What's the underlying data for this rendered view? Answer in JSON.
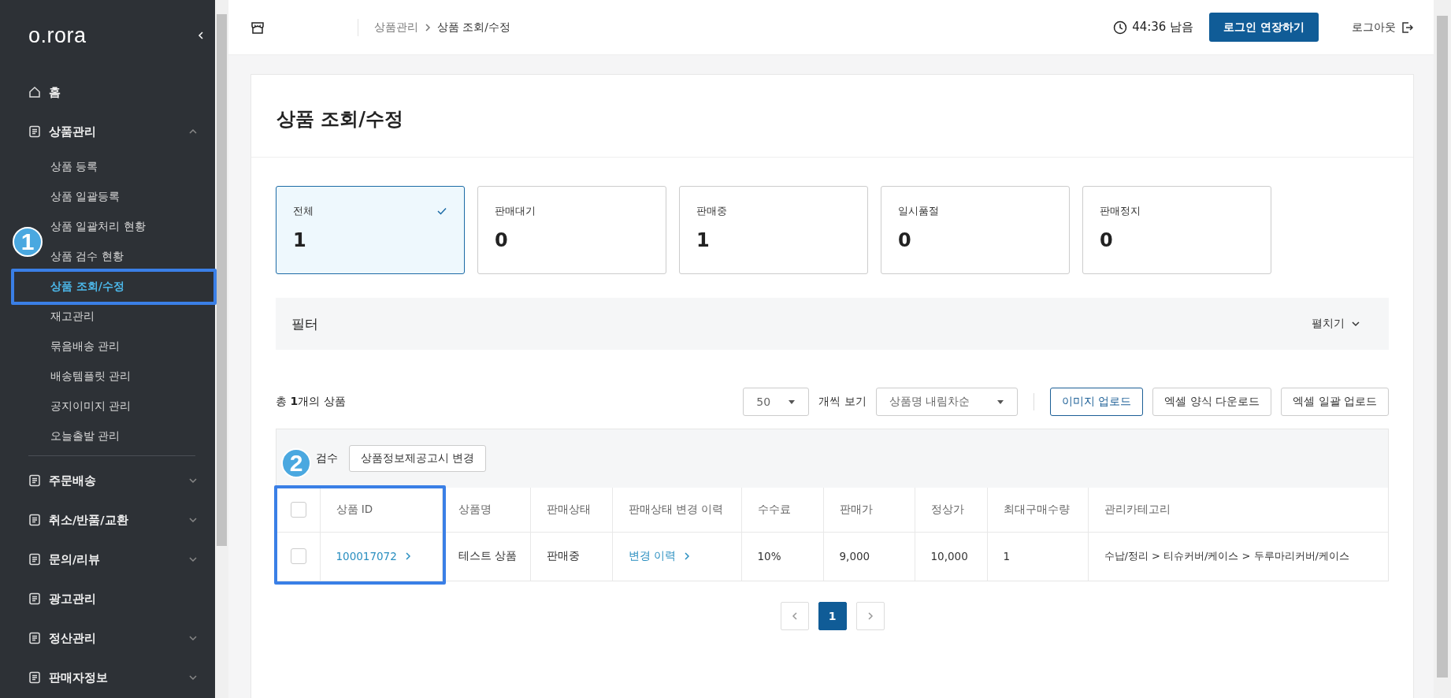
{
  "sidebar": {
    "logo": "o.rora",
    "items": [
      {
        "kind": "home",
        "label": "홈"
      },
      {
        "kind": "group",
        "label": "상품관리",
        "expanded": true,
        "children": [
          {
            "label": "상품 등록",
            "selected": false
          },
          {
            "label": "상품 일괄등록",
            "selected": false
          },
          {
            "label": "상품 일괄처리 현황",
            "selected": false
          },
          {
            "label": "상품 검수 현황",
            "selected": false
          },
          {
            "label": "상품 조회/수정",
            "selected": true
          },
          {
            "label": "재고관리",
            "selected": false
          },
          {
            "label": "묶음배송 관리",
            "selected": false
          },
          {
            "label": "배송템플릿 관리",
            "selected": false
          },
          {
            "label": "공지이미지 관리",
            "selected": false
          },
          {
            "label": "오늘출발 관리",
            "selected": false
          }
        ]
      },
      {
        "kind": "divider"
      },
      {
        "kind": "group",
        "label": "주문배송",
        "expanded": false
      },
      {
        "kind": "group",
        "label": "취소/반품/교환",
        "expanded": false
      },
      {
        "kind": "group",
        "label": "문의/리뷰",
        "expanded": false
      },
      {
        "kind": "link",
        "label": "광고관리"
      },
      {
        "kind": "group",
        "label": "정산관리",
        "expanded": false
      },
      {
        "kind": "group",
        "label": "판매자정보",
        "expanded": false
      }
    ]
  },
  "header": {
    "breadcrumb": [
      "상품관리",
      "상품 조회/수정"
    ],
    "timer": "44:36 남음",
    "extend_button": "로그인 연장하기",
    "logout": "로그아웃"
  },
  "page": {
    "title": "상품 조회/수정",
    "status_cards": [
      {
        "label": "전체",
        "count": "1",
        "selected": true
      },
      {
        "label": "판매대기",
        "count": "0",
        "selected": false
      },
      {
        "label": "판매중",
        "count": "1",
        "selected": false
      },
      {
        "label": "일시품절",
        "count": "0",
        "selected": false
      },
      {
        "label": "판매정지",
        "count": "0",
        "selected": false
      }
    ],
    "filter": {
      "title": "필터",
      "toggle": "펼치기"
    },
    "summary": "총 **1**개의 상품",
    "page_size": "50",
    "page_size_suffix": "개씩 보기",
    "sort": "상품명 내림차순",
    "buttons": [
      {
        "label": "이미지 업로드",
        "kind": "primary"
      },
      {
        "label": "엑셀 양식 다운로드",
        "kind": "plain"
      },
      {
        "label": "엑셀 일괄 업로드",
        "kind": "plain"
      }
    ],
    "table": {
      "actions": [
        {
          "label": "검수",
          "kind": "text"
        },
        {
          "label": "상품정보제공고시 변경",
          "kind": "button"
        }
      ],
      "header_checked": false,
      "columns": [
        "상품 ID",
        "상품명",
        "판매상태",
        "판매상태 변경 이력",
        "수수료",
        "판매가",
        "정상가",
        "최대구매수량",
        "관리카테고리"
      ],
      "rows": [
        {
          "checked": false,
          "cells": [
            {
              "text": "100017072",
              "kind": "link"
            },
            {
              "text": "테스트 상품",
              "kind": "text"
            },
            {
              "text": "판매중",
              "kind": "text"
            },
            {
              "text": "변경 이력",
              "kind": "link"
            },
            {
              "text": "10%",
              "kind": "text"
            },
            {
              "text": "9,000",
              "kind": "text"
            },
            {
              "text": "10,000",
              "kind": "text"
            },
            {
              "text": "1",
              "kind": "text"
            },
            {
              "text": "수납/정리 > 티슈커버/케이스 > 두루마리커버/케이스",
              "kind": "text"
            }
          ]
        }
      ]
    },
    "pagination": {
      "pages": [
        {
          "label": "1",
          "selected": true
        }
      ]
    }
  },
  "annotations": [
    {
      "label": "1"
    },
    {
      "label": "2"
    }
  ]
}
